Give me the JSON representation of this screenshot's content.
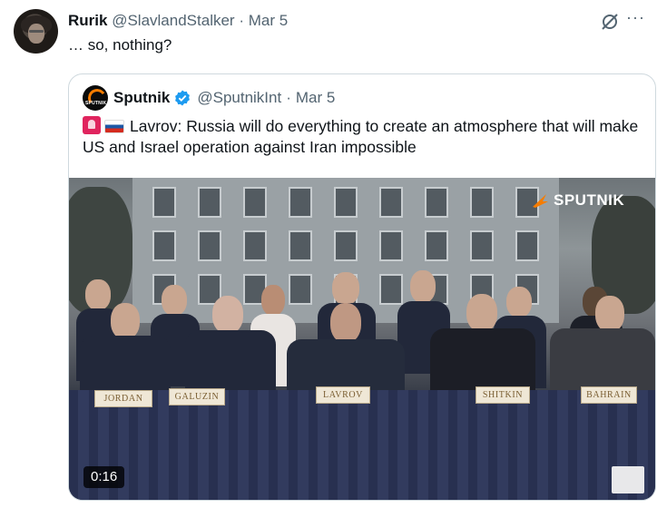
{
  "tweet": {
    "author_name": "Rurik",
    "author_handle": "@SlavlandStalker",
    "separator": "·",
    "date": "Mar 5",
    "text": "… so, nothing?",
    "more_label": "···"
  },
  "quote": {
    "author_name": "Sputnik",
    "author_handle": "@SputnikInt",
    "separator": "·",
    "date": "Mar 5",
    "text": "Lavrov: Russia will do everything to create an atmosphere that will make US and Israel operation against Iran impossible",
    "avatar_text": "SPUTNIK",
    "media": {
      "watermark": "SPUTNIK",
      "duration": "0:16",
      "nameplates": [
        "JORDAN",
        "GALUZIN",
        "LAVROV",
        "SHITKIN",
        "BAHRAIN"
      ]
    }
  },
  "colors": {
    "text": "#0f1419",
    "secondary": "#536471",
    "border": "#cfd9de",
    "verified": "#1d9bf0",
    "sputnik_orange": "#f57c00"
  },
  "icons": [
    "grok-icon",
    "more-icon",
    "verified-badge-icon",
    "siren-emoji",
    "russia-flag-emoji"
  ]
}
